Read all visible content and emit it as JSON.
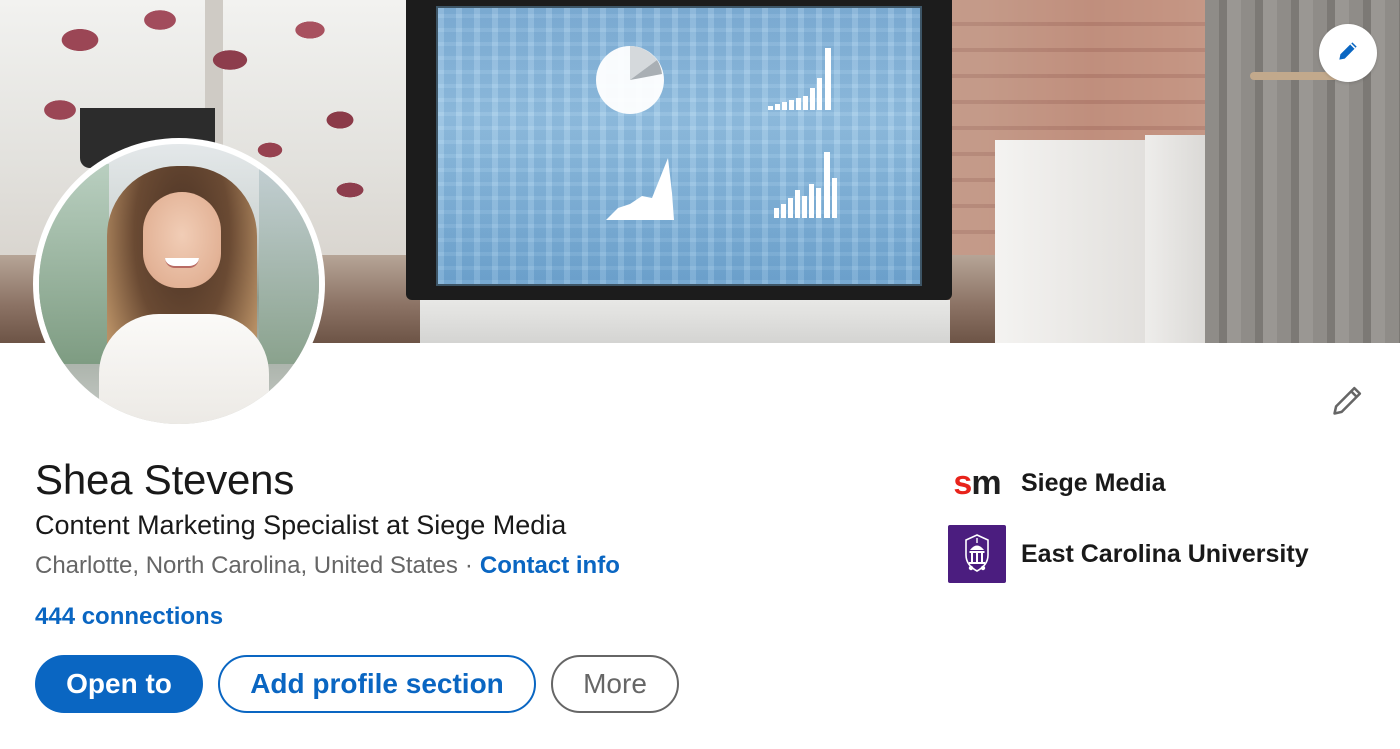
{
  "cover": {
    "edit_icon": "pencil-icon"
  },
  "profile": {
    "name": "Shea Stevens",
    "headline": "Content Marketing Specialist at Siege Media",
    "location": "Charlotte, North Carolina, United States",
    "separator": "·",
    "contact_label": "Contact info",
    "connections": "444 connections",
    "edit_icon": "pencil-icon"
  },
  "actions": {
    "open_to": "Open to",
    "add_section": "Add profile section",
    "more": "More"
  },
  "orgs": [
    {
      "name": "Siege Media",
      "logo_text_s": "s",
      "logo_text_m": "m",
      "logo_colors": [
        "#e8231b",
        "#1f1f1f"
      ]
    },
    {
      "name": "East Carolina University",
      "logo_color": "#4b1d7f"
    }
  ],
  "colors": {
    "link": "#0a66c2",
    "primary_button": "#0a66c2",
    "secondary_text": "#666666"
  }
}
